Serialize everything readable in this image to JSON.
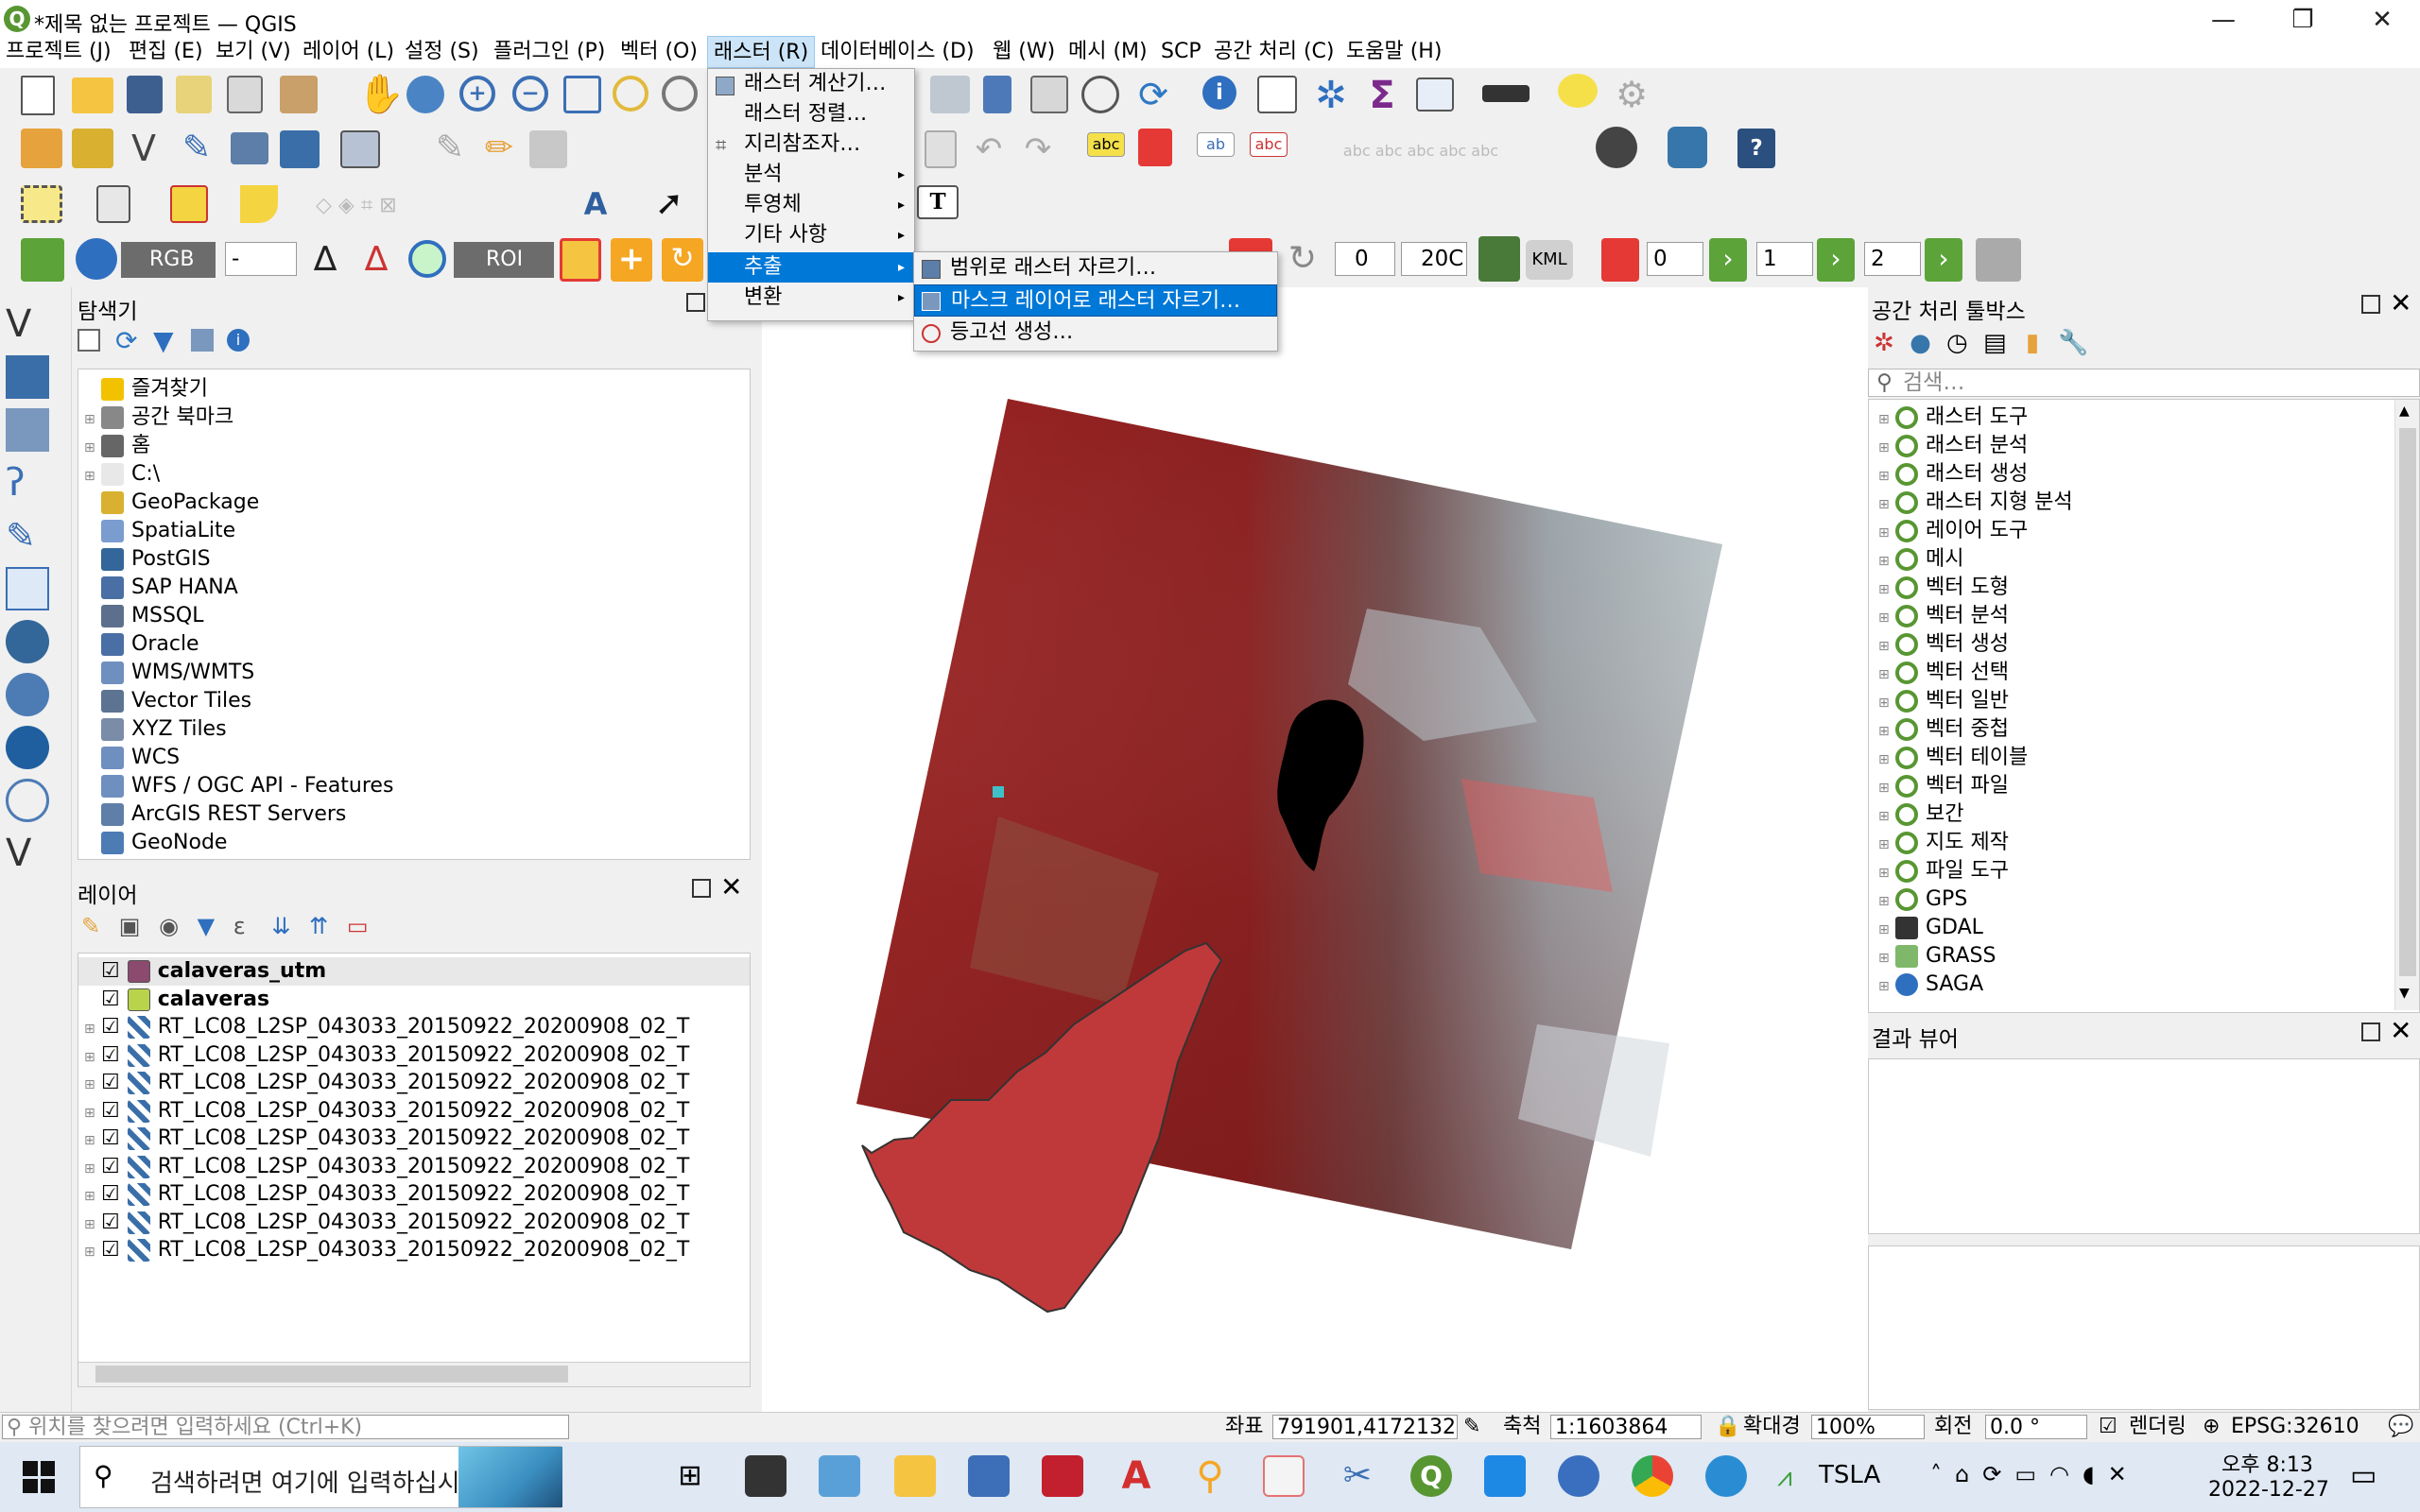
{
  "window": {
    "title": "*제목 없는 프로젝트 — QGIS",
    "minimize_glyph": "—",
    "restore_glyph": "❐",
    "close_glyph": "✕"
  },
  "menubar": [
    {
      "label": "프로젝트 (J)"
    },
    {
      "label": "편집 (E)"
    },
    {
      "label": "보기 (V)"
    },
    {
      "label": "레이어 (L)"
    },
    {
      "label": "설정 (S)"
    },
    {
      "label": "플러그인 (P)"
    },
    {
      "label": "벡터 (O)"
    },
    {
      "label": "래스터 (R)"
    },
    {
      "label": "데이터베이스 (D)"
    },
    {
      "label": "웹 (W)"
    },
    {
      "label": "메시 (M)"
    },
    {
      "label": "SCP"
    },
    {
      "label": "공간 처리 (C)"
    },
    {
      "label": "도움말 (H)"
    }
  ],
  "raster_menu": {
    "items": [
      {
        "label": "래스터 계산기…"
      },
      {
        "label": "래스터 정렬…"
      },
      {
        "label": "지리참조자…"
      },
      {
        "label": "분석"
      },
      {
        "label": "투영체"
      },
      {
        "label": "기타 사항"
      },
      {
        "label": "추출"
      },
      {
        "label": "변환"
      }
    ],
    "extraction_submenu": [
      {
        "label": "범위로 래스터 자르기…"
      },
      {
        "label": "마스크 레이어로 래스터 자르기…"
      },
      {
        "label": "등고선 생성…"
      }
    ]
  },
  "scp_toolbar": {
    "rgb_label": "RGB =",
    "rgb_value": "-",
    "roi_label": "ROI",
    "spin1": "0",
    "spin2": "20C",
    "kml": "KML",
    "band1": "0",
    "band2": "1",
    "band3": "2"
  },
  "browser": {
    "title": "탐색기",
    "items": [
      {
        "label": "즐겨찾기",
        "icon": "star-icon",
        "color": "#f2c200"
      },
      {
        "label": "공간 북마크",
        "icon": "bookmark-icon",
        "color": "#888888"
      },
      {
        "label": "홈",
        "icon": "home-icon",
        "color": "#666666"
      },
      {
        "label": "C:\\",
        "icon": "folder-icon",
        "color": "#e8e8e8"
      },
      {
        "label": "GeoPackage",
        "icon": "geopackage-icon",
        "color": "#d9b02f"
      },
      {
        "label": "SpatiaLite",
        "icon": "spatialite-icon",
        "color": "#7a9ccf"
      },
      {
        "label": "PostGIS",
        "icon": "postgis-icon",
        "color": "#336699"
      },
      {
        "label": "SAP HANA",
        "icon": "saphana-icon",
        "color": "#4a6fa5"
      },
      {
        "label": "MSSQL",
        "icon": "mssql-icon",
        "color": "#5c6f8c"
      },
      {
        "label": "Oracle",
        "icon": "oracle-icon",
        "color": "#4a6fa5"
      },
      {
        "label": "WMS/WMTS",
        "icon": "globe-icon",
        "color": "#6f8fbf"
      },
      {
        "label": "Vector Tiles",
        "icon": "grid-icon",
        "color": "#5d7392"
      },
      {
        "label": "XYZ Tiles",
        "icon": "tiles-icon",
        "color": "#7b8ca8"
      },
      {
        "label": "WCS",
        "icon": "globe-icon",
        "color": "#6f8fbf"
      },
      {
        "label": "WFS / OGC API - Features",
        "icon": "wfs-icon",
        "color": "#6f8fbf"
      },
      {
        "label": "ArcGIS REST Servers",
        "icon": "arcgis-icon",
        "color": "#5f7fa8"
      },
      {
        "label": "GeoNode",
        "icon": "geonode-icon",
        "color": "#4d7cb5"
      }
    ]
  },
  "layers": {
    "title": "레이어",
    "items": [
      {
        "label": "calaveras_utm",
        "color": "#8b4a6e",
        "bold": true
      },
      {
        "label": "calaveras",
        "color": "#b9d44a",
        "bold": true
      },
      {
        "label": "RT_LC08_L2SP_043033_20150922_20200908_02_T"
      },
      {
        "label": "RT_LC08_L2SP_043033_20150922_20200908_02_T"
      },
      {
        "label": "RT_LC08_L2SP_043033_20150922_20200908_02_T"
      },
      {
        "label": "RT_LC08_L2SP_043033_20150922_20200908_02_T"
      },
      {
        "label": "RT_LC08_L2SP_043033_20150922_20200908_02_T"
      },
      {
        "label": "RT_LC08_L2SP_043033_20150922_20200908_02_T"
      },
      {
        "label": "RT_LC08_L2SP_043033_20150922_20200908_02_T"
      },
      {
        "label": "RT_LC08_L2SP_043033_20150922_20200908_02_T"
      },
      {
        "label": "RT_LC08_L2SP_043033_20150922_20200908_02_T"
      }
    ]
  },
  "processing": {
    "title": "공간 처리 툴박스",
    "search_placeholder": "검색…",
    "items": [
      {
        "label": "래스터 도구"
      },
      {
        "label": "래스터 분석"
      },
      {
        "label": "래스터 생성"
      },
      {
        "label": "래스터 지형 분석"
      },
      {
        "label": "레이어 도구"
      },
      {
        "label": "메시"
      },
      {
        "label": "벡터 도형"
      },
      {
        "label": "벡터 분석"
      },
      {
        "label": "벡터 생성"
      },
      {
        "label": "벡터 선택"
      },
      {
        "label": "벡터 일반"
      },
      {
        "label": "벡터 중첩"
      },
      {
        "label": "벡터 테이블"
      },
      {
        "label": "벡터 파일"
      },
      {
        "label": "보간"
      },
      {
        "label": "지도 제작"
      },
      {
        "label": "파일 도구"
      },
      {
        "label": "GPS"
      },
      {
        "label": "GDAL"
      },
      {
        "label": "GRASS"
      },
      {
        "label": "SAGA"
      }
    ]
  },
  "results": {
    "title": "결과 뷰어"
  },
  "statusbar": {
    "locator_placeholder": "위치를 찾으려면 입력하세요 (Ctrl+K)",
    "coord_label": "좌표",
    "coord_value": "791901,4172132",
    "scale_label": "축척",
    "scale_value": "1:1603864",
    "magnifier_label": "확대경",
    "magnifier_value": "100%",
    "rotation_label": "회전",
    "rotation_value": "0.0 °",
    "render_label": "렌더링",
    "crs": "EPSG:32610"
  },
  "taskbar": {
    "search_placeholder": "검색하려면 여기에 입력하십시",
    "stock": "TSLA",
    "time": "오후 8:13",
    "date": "2022-12-27"
  },
  "colors": {
    "accent": "#0078d7",
    "qgis_green": "#589632",
    "raster_red": "#8a1e1e",
    "mask_red": "#c0393a"
  }
}
